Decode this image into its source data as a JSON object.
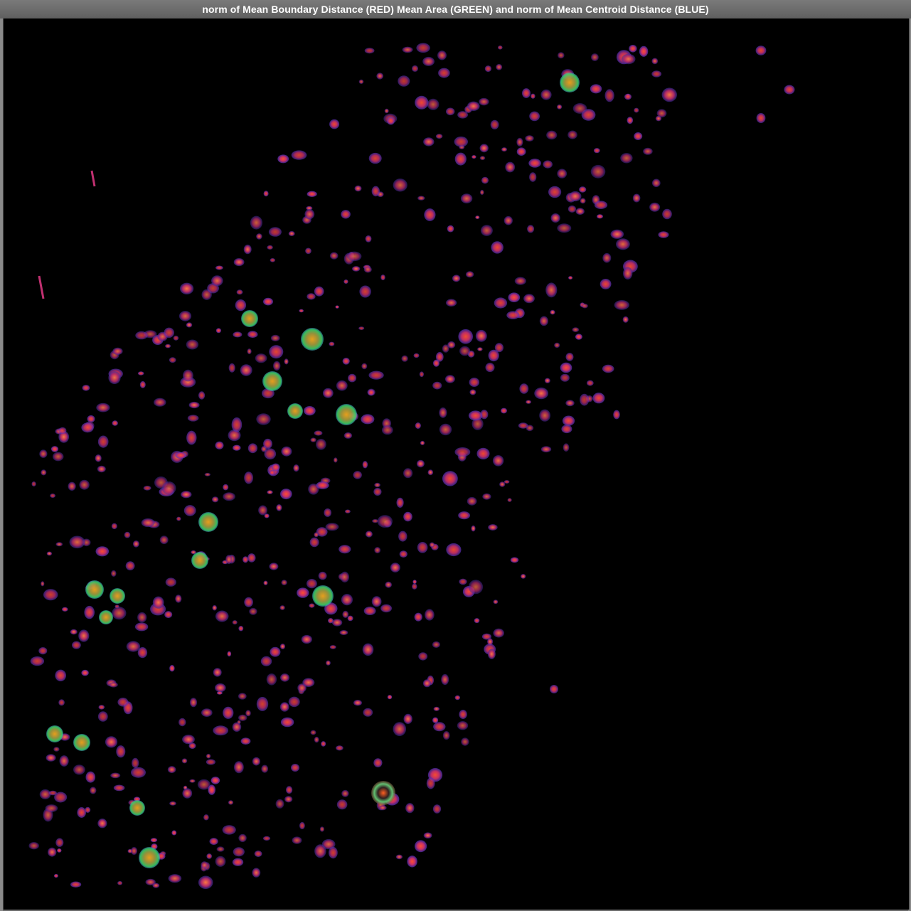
{
  "window": {
    "title": "norm of Mean Boundary Distance (RED) Mean Area (GREEN) and norm of Mean Centroid Distance (BLUE)"
  },
  "colors": {
    "background": "#000000",
    "red_channel": "#ff2a2a",
    "green_channel": "#3cff6a",
    "blue_channel": "#3a4cff",
    "typical_blob": "#d0306a",
    "large_blob": "#c8a838"
  }
}
